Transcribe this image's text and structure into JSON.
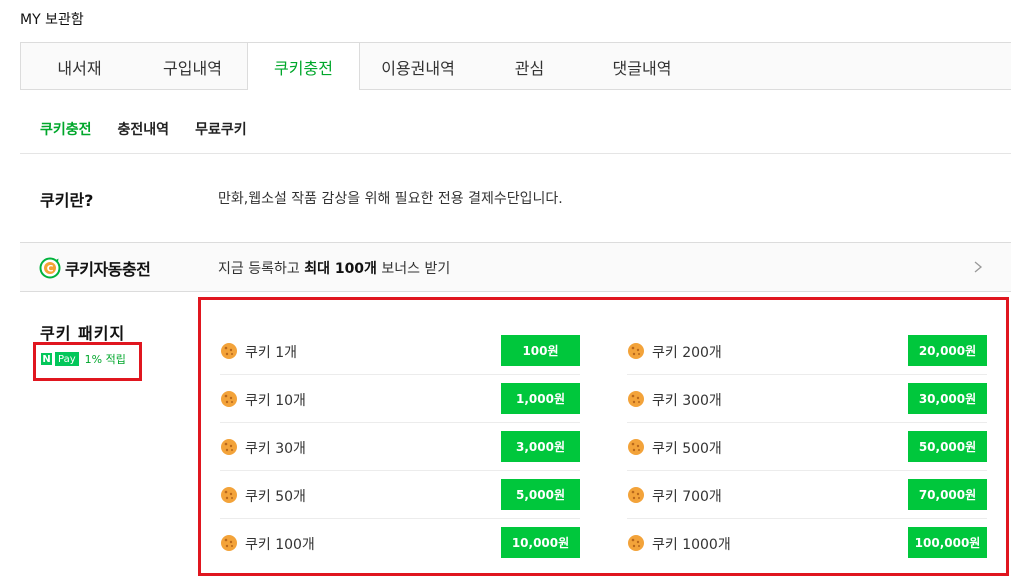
{
  "page_title": "MY 보관함",
  "main_tabs": [
    {
      "label": "내서재",
      "active": false
    },
    {
      "label": "구입내역",
      "active": false
    },
    {
      "label": "쿠키충전",
      "active": true
    },
    {
      "label": "이용권내역",
      "active": false
    },
    {
      "label": "관심",
      "active": false
    },
    {
      "label": "댓글내역",
      "active": false
    }
  ],
  "sub_tabs": [
    {
      "label": "쿠키충전",
      "active": true
    },
    {
      "label": "충전내역",
      "active": false
    },
    {
      "label": "무료쿠키",
      "active": false
    }
  ],
  "cookie_info": {
    "label": "쿠키란?",
    "description": "만화,웹소설 작품 감상을 위해 필요한 전용 결제수단입니다."
  },
  "auto_charge": {
    "logo_text": "쿠키자동충전",
    "text_pre": "지금 등록하고 ",
    "text_bold": "최대 100개",
    "text_post": " 보너스 받기",
    "logo_icon": "cookie-c-icon",
    "chevron_icon": "chevron-right-icon"
  },
  "packages": {
    "label": "쿠키 패키지",
    "npay_n": "N",
    "npay_pay": "Pay",
    "npay_text": "1% 적립",
    "left": [
      {
        "name": "쿠키 1개",
        "price": "100원"
      },
      {
        "name": "쿠키 10개",
        "price": "1,000원"
      },
      {
        "name": "쿠키 30개",
        "price": "3,000원"
      },
      {
        "name": "쿠키 50개",
        "price": "5,000원"
      },
      {
        "name": "쿠키 100개",
        "price": "10,000원"
      }
    ],
    "right": [
      {
        "name": "쿠키 200개",
        "price": "20,000원"
      },
      {
        "name": "쿠키 300개",
        "price": "30,000원"
      },
      {
        "name": "쿠키 500개",
        "price": "50,000원"
      },
      {
        "name": "쿠키 700개",
        "price": "70,000원"
      },
      {
        "name": "쿠키 1000개",
        "price": "100,000원"
      }
    ]
  },
  "colors": {
    "accent": "#00a72b",
    "button": "#00c73c",
    "highlight_border": "#e0161f"
  }
}
